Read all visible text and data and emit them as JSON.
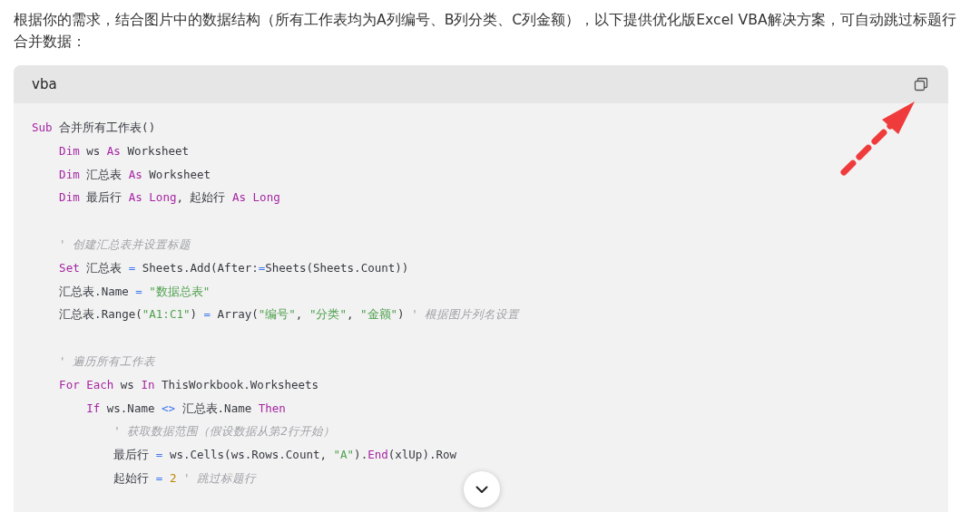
{
  "intro": "根据你的需求，结合图片中的数据结构（所有工作表均为A列编号、B列分类、C列金额），以下提供优化版Excel VBA解决方案，可自动跳过标题行合并数据：",
  "code_block": {
    "language": "vba",
    "lines": [
      {
        "kind": "code",
        "tokens": [
          {
            "kind": "kw",
            "text": "Sub"
          },
          {
            "kind": "plain",
            "text": " 合并所有工作表()"
          }
        ]
      },
      {
        "kind": "code",
        "tokens": [
          {
            "kind": "kw",
            "text": "    Dim"
          },
          {
            "kind": "plain",
            "text": " ws "
          },
          {
            "kind": "kw",
            "text": "As"
          },
          {
            "kind": "plain",
            "text": " Worksheet"
          }
        ]
      },
      {
        "kind": "code",
        "tokens": [
          {
            "kind": "kw",
            "text": "    Dim"
          },
          {
            "kind": "plain",
            "text": " 汇总表 "
          },
          {
            "kind": "kw",
            "text": "As"
          },
          {
            "kind": "plain",
            "text": " Worksheet"
          }
        ]
      },
      {
        "kind": "code",
        "tokens": [
          {
            "kind": "kw",
            "text": "    Dim"
          },
          {
            "kind": "plain",
            "text": " 最后行 "
          },
          {
            "kind": "kw",
            "text": "As Long"
          },
          {
            "kind": "plain",
            "text": ", 起始行 "
          },
          {
            "kind": "kw",
            "text": "As Long"
          }
        ]
      },
      {
        "kind": "blank"
      },
      {
        "kind": "code",
        "tokens": [
          {
            "kind": "comment",
            "text": "    ' 创建汇总表并设置标题"
          }
        ]
      },
      {
        "kind": "code",
        "tokens": [
          {
            "kind": "kw",
            "text": "    Set"
          },
          {
            "kind": "plain",
            "text": " 汇总表 "
          },
          {
            "kind": "op",
            "text": "="
          },
          {
            "kind": "plain",
            "text": " Sheets.Add(After:"
          },
          {
            "kind": "op",
            "text": "="
          },
          {
            "kind": "plain",
            "text": "Sheets(Sheets.Count))"
          }
        ]
      },
      {
        "kind": "code",
        "tokens": [
          {
            "kind": "plain",
            "text": "    汇总表.Name "
          },
          {
            "kind": "op",
            "text": "="
          },
          {
            "kind": "str",
            "text": " \"数据总表\""
          }
        ]
      },
      {
        "kind": "code",
        "tokens": [
          {
            "kind": "plain",
            "text": "    汇总表.Range("
          },
          {
            "kind": "str",
            "text": "\"A1:C1\""
          },
          {
            "kind": "plain",
            "text": ") "
          },
          {
            "kind": "op",
            "text": "="
          },
          {
            "kind": "plain",
            "text": " Array("
          },
          {
            "kind": "str",
            "text": "\"编号\""
          },
          {
            "kind": "plain",
            "text": ", "
          },
          {
            "kind": "str",
            "text": "\"分类\""
          },
          {
            "kind": "plain",
            "text": ", "
          },
          {
            "kind": "str",
            "text": "\"金额\""
          },
          {
            "kind": "plain",
            "text": ") "
          },
          {
            "kind": "comment",
            "text": "' 根据图片列名设置"
          }
        ]
      },
      {
        "kind": "blank"
      },
      {
        "kind": "code",
        "tokens": [
          {
            "kind": "comment",
            "text": "    ' 遍历所有工作表"
          }
        ]
      },
      {
        "kind": "code",
        "tokens": [
          {
            "kind": "kw",
            "text": "    For Each"
          },
          {
            "kind": "plain",
            "text": " ws "
          },
          {
            "kind": "kw",
            "text": "In"
          },
          {
            "kind": "plain",
            "text": " ThisWorkbook.Worksheets"
          }
        ]
      },
      {
        "kind": "code",
        "tokens": [
          {
            "kind": "kw",
            "text": "        If"
          },
          {
            "kind": "plain",
            "text": " ws.Name "
          },
          {
            "kind": "op",
            "text": "<>"
          },
          {
            "kind": "plain",
            "text": " 汇总表.Name "
          },
          {
            "kind": "kw",
            "text": "Then"
          }
        ]
      },
      {
        "kind": "code",
        "tokens": [
          {
            "kind": "comment",
            "text": "            ' 获取数据范围（假设数据从第2行开始）"
          }
        ]
      },
      {
        "kind": "code",
        "tokens": [
          {
            "kind": "plain",
            "text": "            最后行 "
          },
          {
            "kind": "op",
            "text": "="
          },
          {
            "kind": "plain",
            "text": " ws.Cells(ws.Rows.Count, "
          },
          {
            "kind": "str",
            "text": "\"A\""
          },
          {
            "kind": "plain",
            "text": ")."
          },
          {
            "kind": "kw",
            "text": "End"
          },
          {
            "kind": "plain",
            "text": "(xlUp).Row"
          }
        ]
      },
      {
        "kind": "code",
        "tokens": [
          {
            "kind": "plain",
            "text": "            起始行 "
          },
          {
            "kind": "op",
            "text": "="
          },
          {
            "kind": "num",
            "text": " 2"
          },
          {
            "kind": "comment",
            "text": " ' 跳过标题行"
          }
        ]
      }
    ]
  }
}
